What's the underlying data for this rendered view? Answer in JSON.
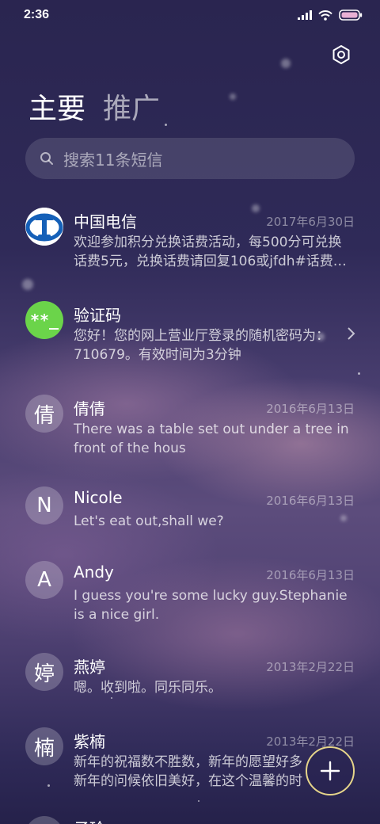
{
  "status_bar": {
    "time": "2:36",
    "icons": [
      "signal-icon",
      "wifi-icon",
      "battery-icon"
    ]
  },
  "header": {
    "settings_icon": "settings-icon",
    "tabs": [
      {
        "label": "主要",
        "active": true
      },
      {
        "label": "推广",
        "active": false
      }
    ]
  },
  "search": {
    "placeholder": "搜索11条短信"
  },
  "messages": [
    {
      "name": "中国电信",
      "date": "2017年6月30日",
      "avatar": "china-telecom-logo",
      "preview": [
        "欢迎参加积分兑换话费活动，每500分可兑换",
        "话费5元，兑换话费请回复106或jfdh#话费…"
      ]
    },
    {
      "name": "验证码",
      "date": "",
      "avatar_text": "**_",
      "preview": [
        "您好！您的网上营业厅登录的随机密码为：",
        "710679。有效时间为3分钟"
      ]
    },
    {
      "name": "倩倩",
      "date": "2016年6月13日",
      "avatar_text": "倩",
      "preview": [
        "There was a table set out under a tree in",
        "front of the hous"
      ]
    },
    {
      "name": "Nicole",
      "date": "2016年6月13日",
      "avatar_text": "N",
      "preview": [
        "Let's eat out,shall we?"
      ]
    },
    {
      "name": "Andy",
      "date": "2016年6月13日",
      "avatar_text": "A",
      "preview": [
        "I guess you're some lucky guy.Stephanie",
        "is a nice girl."
      ]
    },
    {
      "name": "燕婷",
      "date": "2013年2月22日",
      "avatar_text": "婷",
      "preview": [
        "嗯。收到啦。同乐同乐。"
      ]
    },
    {
      "name": "紫楠",
      "date": "2013年2月22日",
      "avatar_text": "楠",
      "preview": [
        "新年的祝福数不胜数，新年的愿望好多",
        "新年的问候依旧美好，在这个温馨的时"
      ]
    },
    {
      "name": "子玲",
      "date": "",
      "avatar_text": "",
      "preview": []
    }
  ],
  "fab": {
    "icon": "plus-icon",
    "accent": "#e6d58a"
  },
  "colors": {
    "verification_avatar": "#6bd44a",
    "telecom_blue": "#1560b8"
  }
}
